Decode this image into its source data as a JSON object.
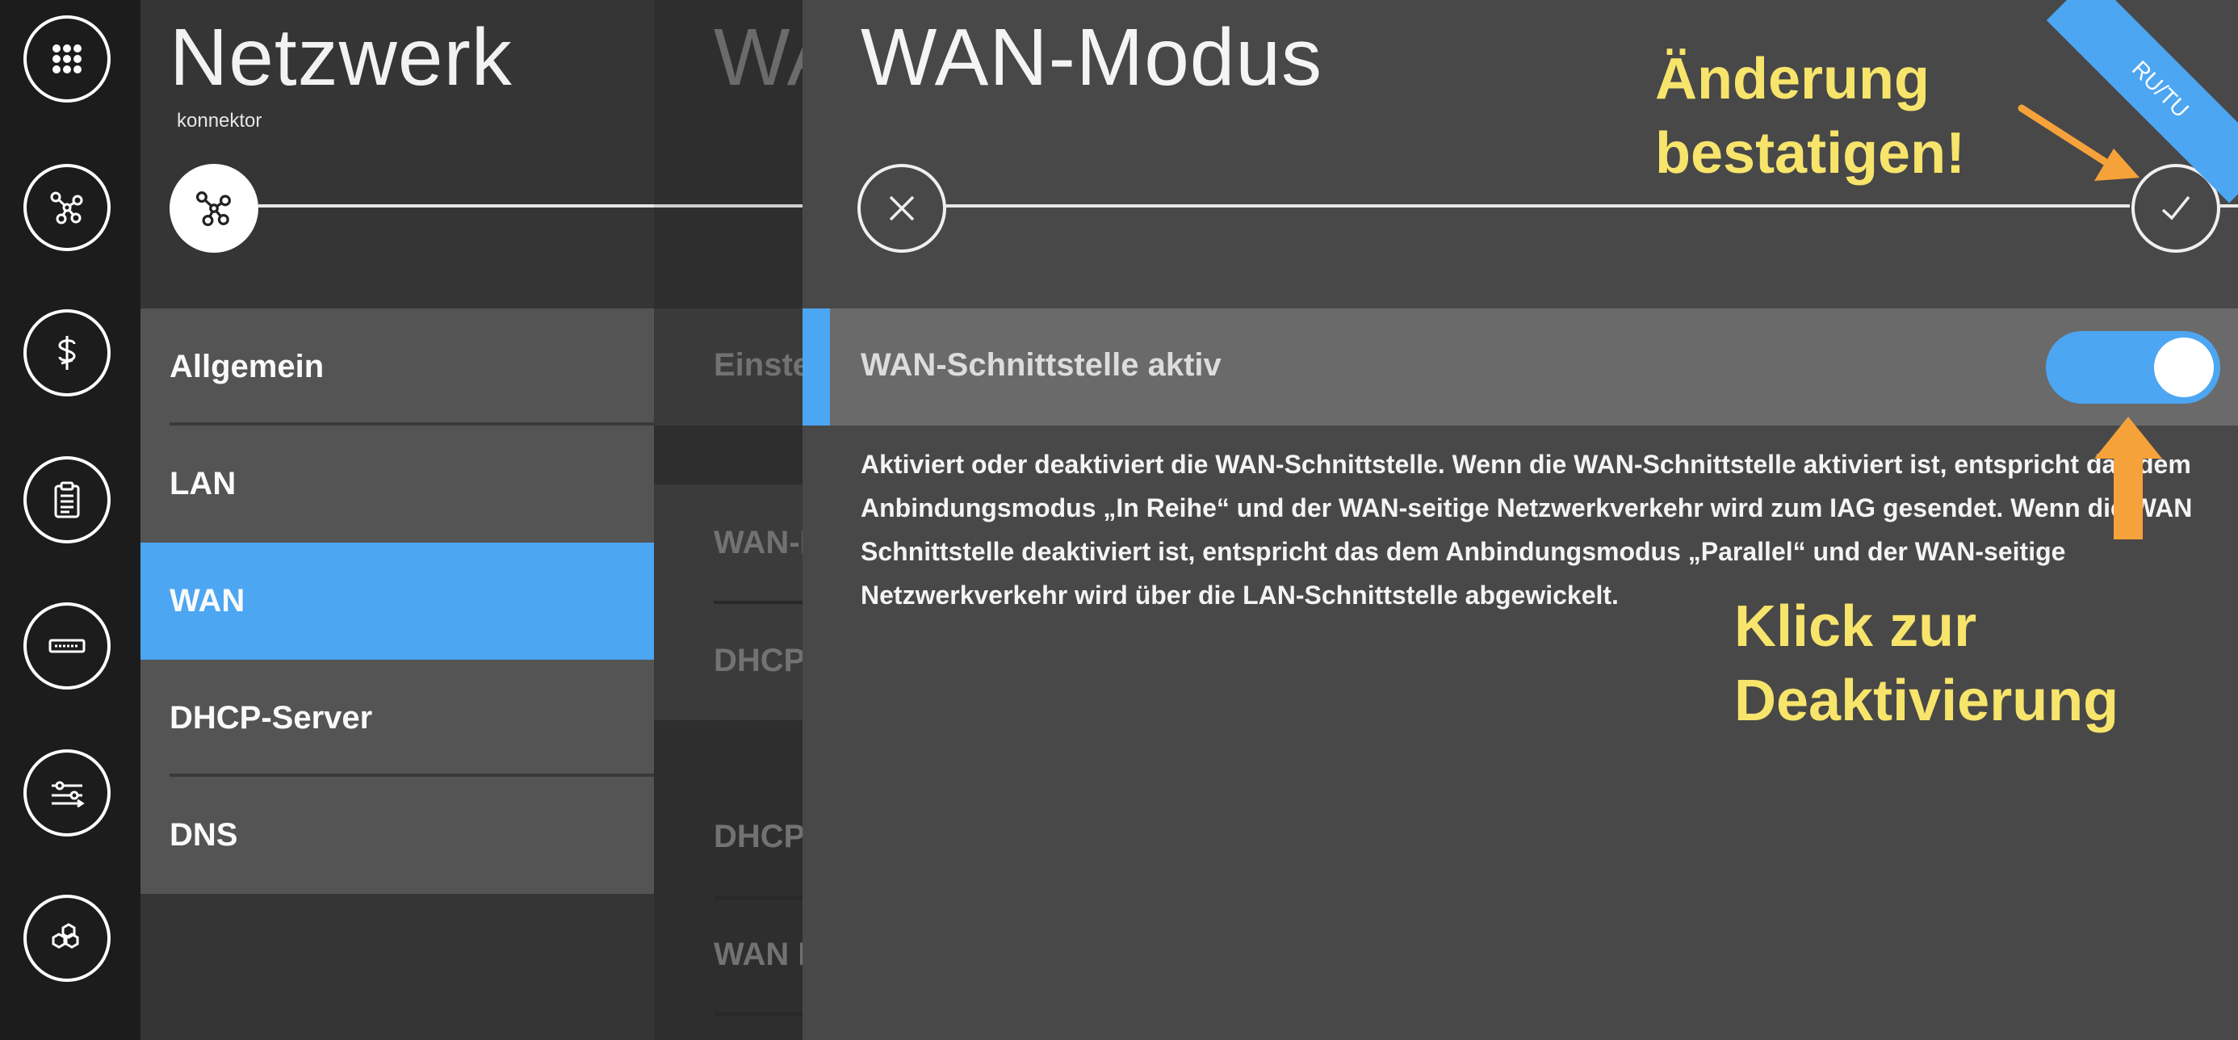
{
  "rail": {
    "items": [
      {
        "name": "apps-grid-icon"
      },
      {
        "name": "network-icon"
      },
      {
        "name": "medical-icon"
      },
      {
        "name": "clipboard-icon"
      },
      {
        "name": "card-reader-icon"
      },
      {
        "name": "transfer-icon"
      },
      {
        "name": "modules-icon"
      }
    ]
  },
  "network": {
    "title": "Netzwerk",
    "subtitle": "konnektor",
    "menu": [
      "Allgemein",
      "LAN",
      "WAN",
      "DHCP-Server",
      "DNS"
    ],
    "active_index": 2
  },
  "middle": {
    "title": "WA",
    "items": [
      "Einste",
      "WAN-I",
      "DHCP",
      "DHCP",
      "WAN I"
    ]
  },
  "panel": {
    "title": "WAN-Modus",
    "setting_label": "WAN-Schnittstelle aktiv",
    "toggle_on": true,
    "description": "Aktiviert oder deaktiviert die WAN-Schnittstelle. Wenn die WAN-Schnittstelle aktiviert ist, entspricht das dem Anbindungsmodus „In Reihe“ und der WAN-seitige Netzwerkverkehr wird zum IAG gesendet. Wenn die WAN Schnittstelle deaktiviert ist, entspricht das dem Anbindungsmodus „Parallel“ und der WAN-seitige Netzwerkverkehr wird über die LAN-Schnittstelle abgewickelt."
  },
  "ribbon": "RU/TU",
  "annotations": {
    "confirm_line1": "Änderung",
    "confirm_line2": "bestatigen!",
    "click_line1": "Klick zur",
    "click_line2": "Deaktivierung"
  },
  "colors": {
    "accent": "#4ca6f2",
    "annotation_text": "#f7e46b",
    "annotation_arrow": "#f6a23a"
  }
}
